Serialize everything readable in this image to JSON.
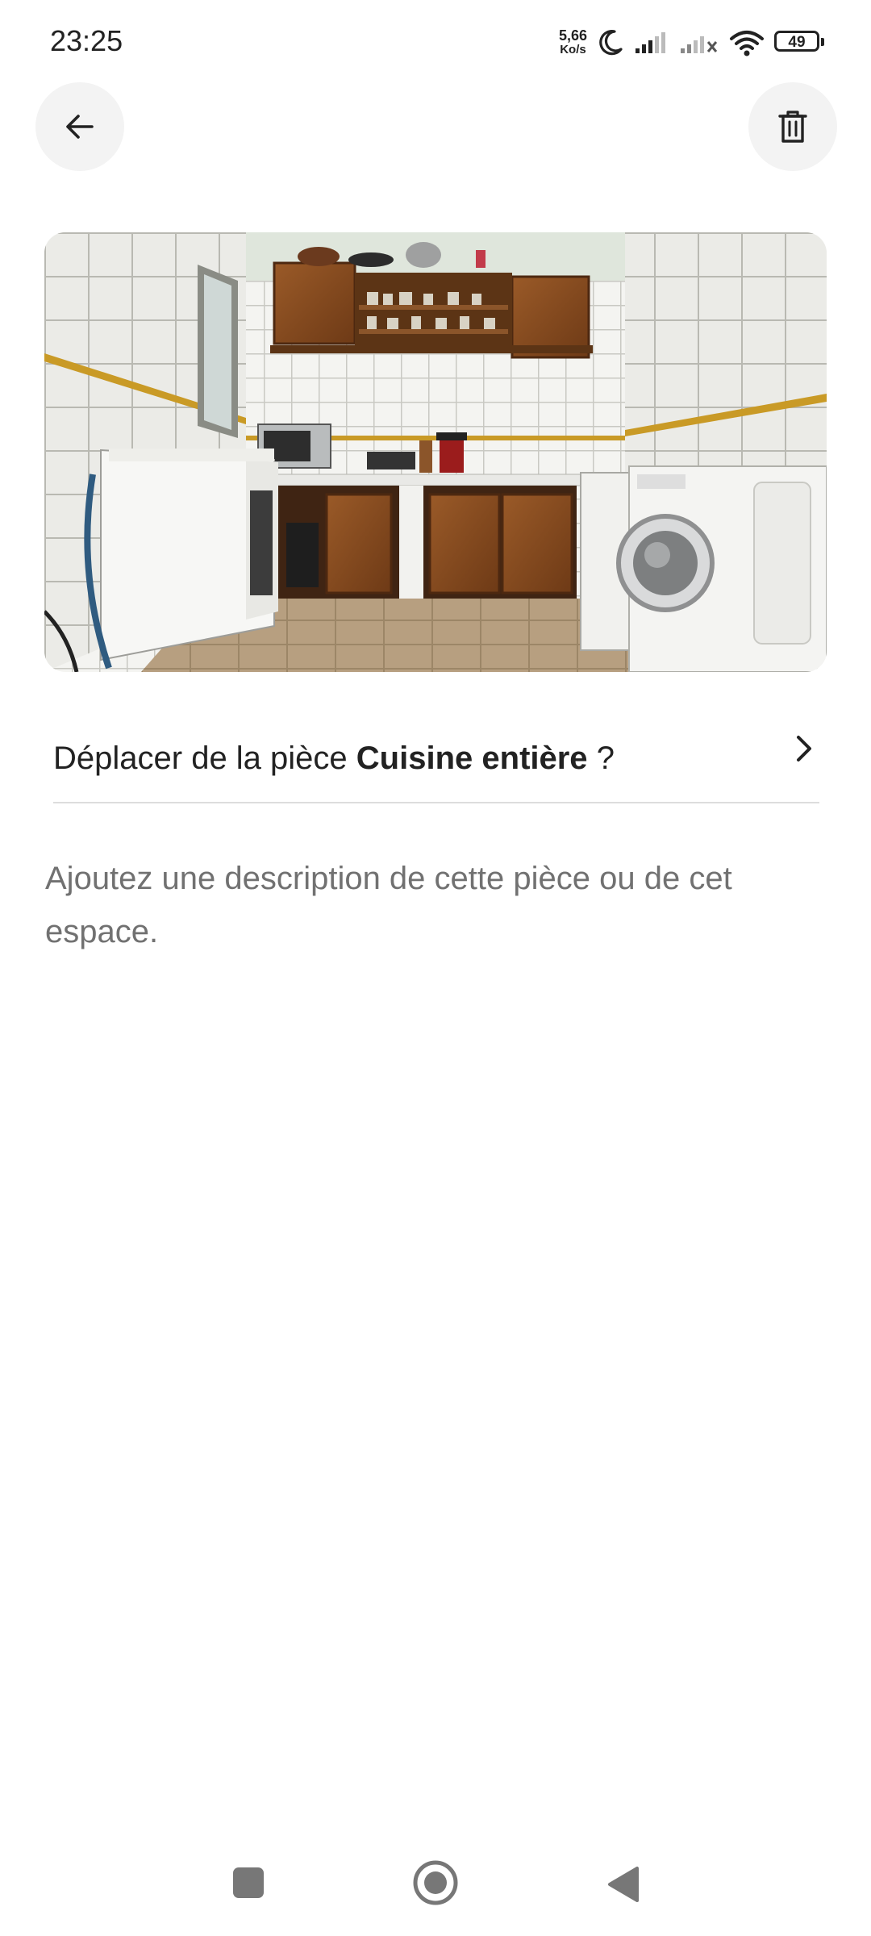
{
  "status_bar": {
    "time": "23:25",
    "net_speed_value": "5,66",
    "net_speed_unit": "Ko/s",
    "battery_level": "49",
    "icons": [
      "moon-icon",
      "signal-icon",
      "signal-no-service-icon",
      "wifi-icon",
      "battery-icon"
    ]
  },
  "header": {
    "back_icon": "arrow-left-icon",
    "delete_icon": "trash-icon"
  },
  "photo": {
    "subject": "kitchen"
  },
  "room_move": {
    "prefix": "Déplacer de la pièce",
    "room_name": "Cuisine entière",
    "suffix": "?",
    "icon": "chevron-right-icon"
  },
  "description": {
    "placeholder": "Ajoutez une description de cette pièce ou de cet espace."
  },
  "nav_bar": {
    "icons": [
      "recent-apps-icon",
      "home-icon",
      "back-icon"
    ]
  },
  "colors": {
    "background": "#ffffff",
    "text": "#222222",
    "muted_text": "#717171",
    "button_bg": "#f3f3f3",
    "divider": "#dddddd"
  }
}
